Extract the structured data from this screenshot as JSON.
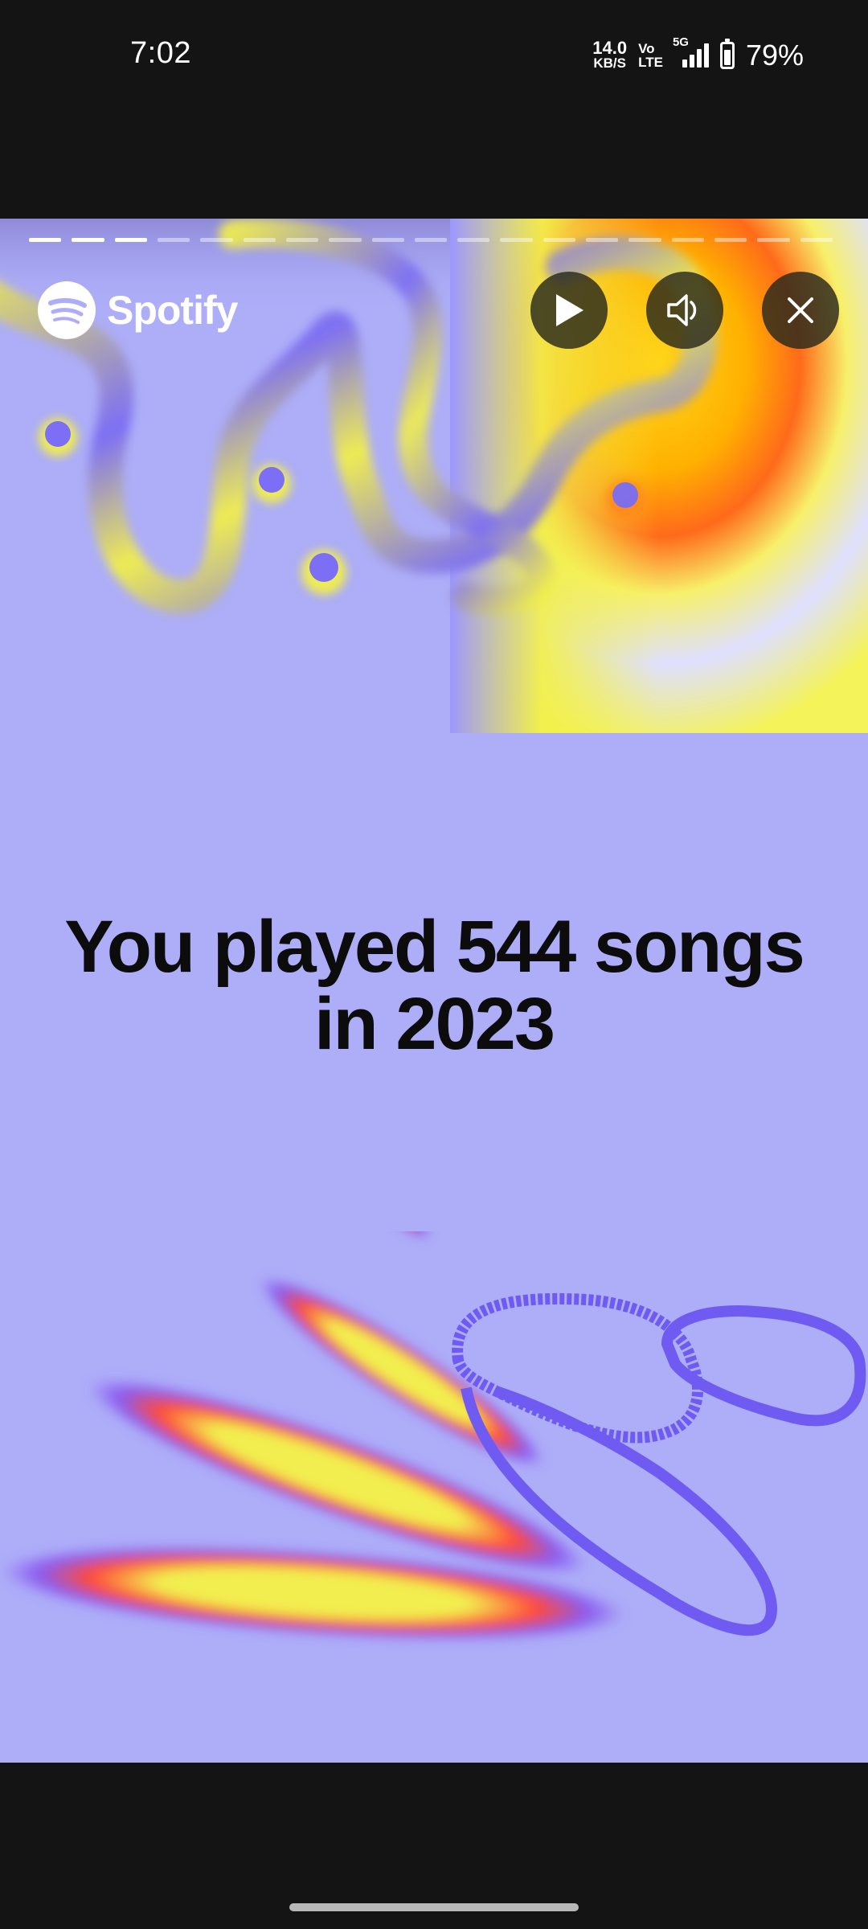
{
  "status_bar": {
    "time": "7:02",
    "net_speed": "14.0",
    "net_speed_unit": "KB/S",
    "volte_top": "Vo",
    "volte_bottom": "LTE",
    "network": "5G",
    "battery_percent": "79%",
    "battery_level": 0.79
  },
  "story": {
    "brand": "Spotify",
    "headline": "You played 544 songs in 2023",
    "progress_total": 19,
    "progress_done": 3,
    "controls": {
      "play_icon": "play-icon",
      "mute_icon": "speaker-muted-icon",
      "close_icon": "close-icon"
    },
    "colors": {
      "background": "#adadf8",
      "accent_yellow": "#f2f04a",
      "accent_orange": "#ff6a1a",
      "accent_purple": "#6f5bf2"
    }
  }
}
